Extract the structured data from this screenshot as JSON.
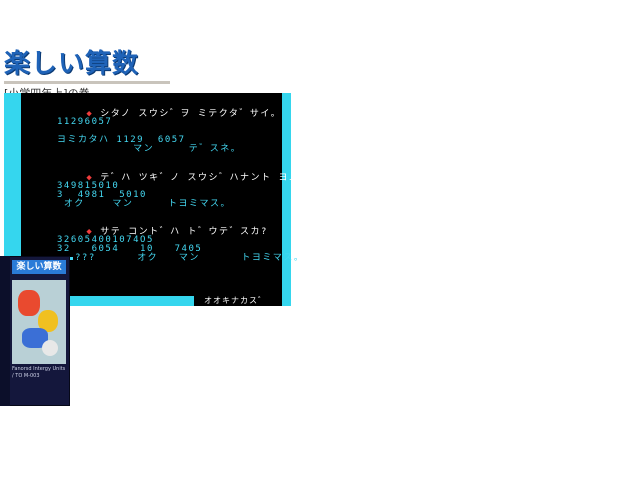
{
  "header": {
    "logo": "楽しい算数",
    "subtitle": "[小学四年上]の巻"
  },
  "game": {
    "lines": [
      {
        "kind": "q",
        "bullet": "◆",
        "text": "シタノ スウシ゛ヲ ミテクタ゛サイ。"
      },
      {
        "kind": "a",
        "text": "11296057"
      },
      {
        "kind": "a",
        "text": "ヨミカタハ 1129  6057"
      },
      {
        "kind": "a",
        "text": "           マン     テ゛スネ。"
      },
      {
        "kind": "q",
        "bullet": "◆",
        "text": "テ゛ハ ツキ゛ノ スウシ゛ハナント ヨムテ゛ショウ?"
      },
      {
        "kind": "a",
        "text": "349815010"
      },
      {
        "kind": "a",
        "text": "3  4981  5010"
      },
      {
        "kind": "a",
        "text": " オク    マン     トヨミマス。"
      },
      {
        "kind": "q",
        "bullet": "◆",
        "text": "サテ コント゛ハ ト゛ウテ゛スカ?"
      },
      {
        "kind": "a",
        "text": "326054001074O5"
      },
      {
        "kind": "a",
        "text": "32   6054   10   7405"
      },
      {
        "kind": "a",
        "text": "???      オク   マン      トヨミマス。"
      }
    ],
    "status": "オオキナカス゛"
  },
  "box": {
    "title": "楽しい算数",
    "footer": "Fanorsd Intergy Units / TO M-003"
  },
  "colors": {
    "screen_border": "#35d6ee",
    "answer_text": "#44d8f2",
    "bullet": "#f03c3c",
    "logo": "#1f63b8"
  }
}
